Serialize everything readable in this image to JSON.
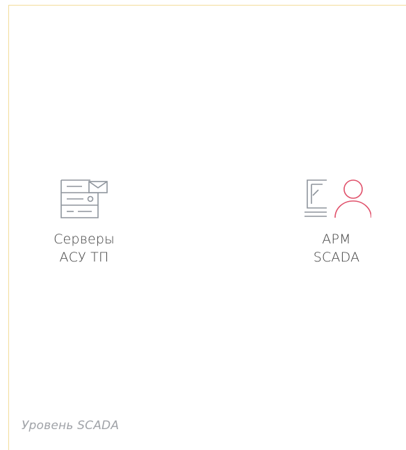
{
  "nodes": {
    "servers": {
      "icon": "server-mail-icon",
      "label_line1": "Серверы",
      "label_line2": "АСУ ТП"
    },
    "arm": {
      "icon": "workstation-user-icon",
      "label_line1": "АРМ",
      "label_line2": "SCADA"
    }
  },
  "level_label": "Уровень SCADA",
  "colors": {
    "frame_border": "#f3dc9a",
    "icon_gray": "#8e949c",
    "accent_red": "#e0506a",
    "text": "#3b3b3b",
    "level_text": "#a0a3a8"
  }
}
